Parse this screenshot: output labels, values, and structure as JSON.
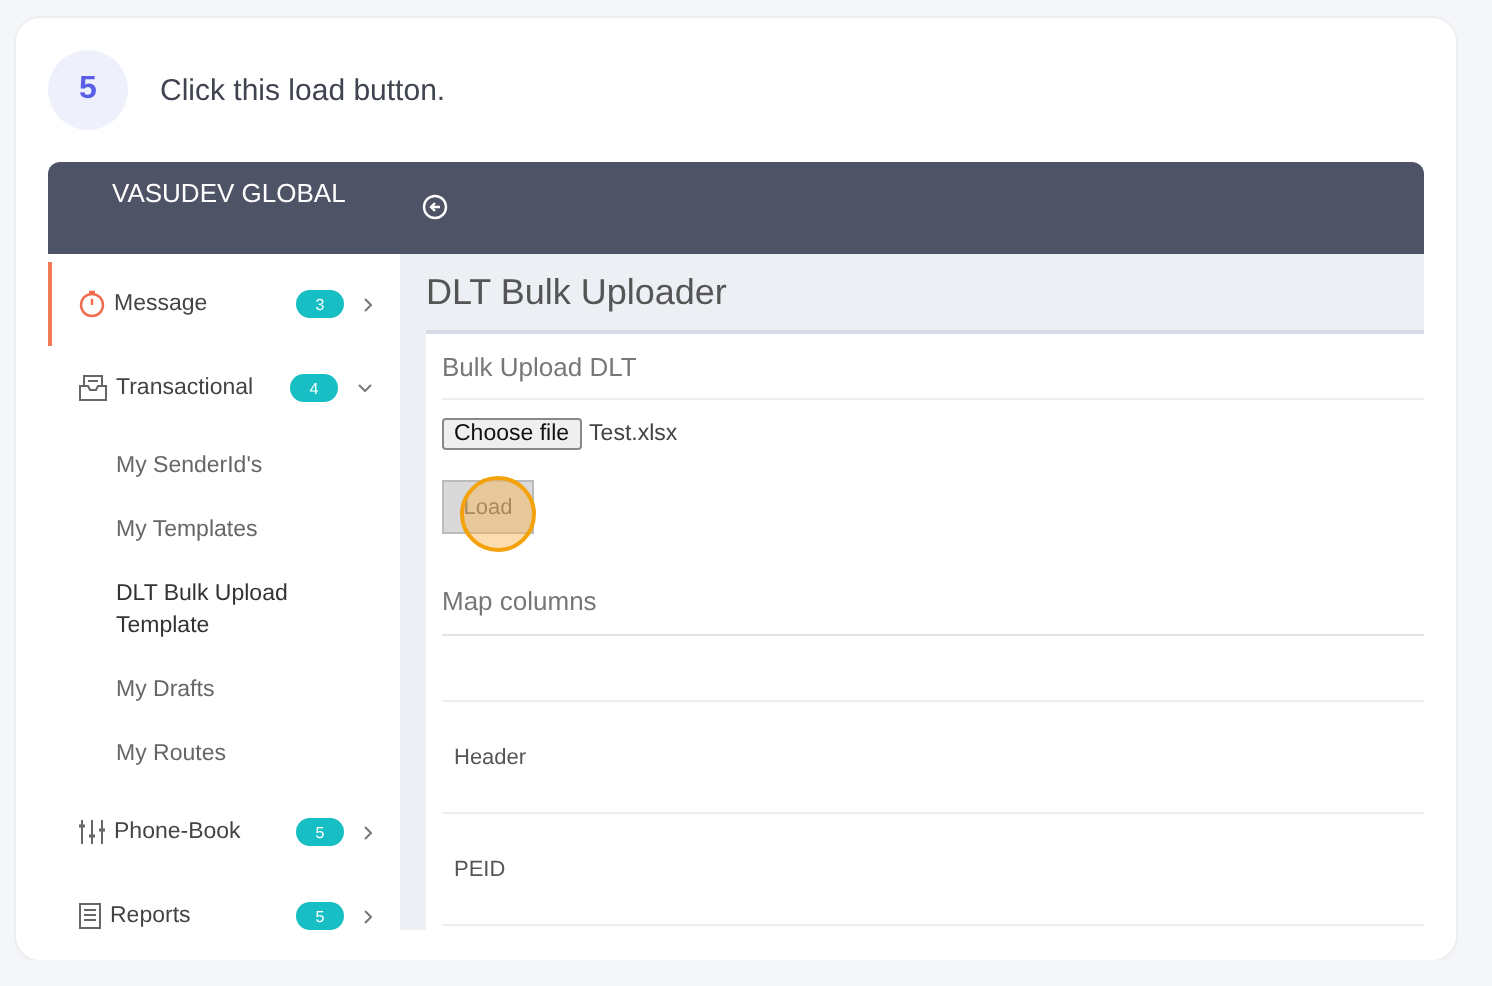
{
  "step": {
    "number": "5",
    "instruction": "Click this load button."
  },
  "app": {
    "brand": "VASUDEV GLOBAL",
    "sidebar": [
      {
        "label": "Message",
        "badge": "3",
        "selected": true,
        "expanded": false
      },
      {
        "label": "Transactional",
        "badge": "4",
        "selected": false,
        "expanded": true,
        "children": [
          {
            "label": "My SenderId's",
            "selected": false
          },
          {
            "label": "My Templates",
            "selected": false
          },
          {
            "label": "DLT Bulk Upload Template",
            "selected": true
          },
          {
            "label": "My Drafts",
            "selected": false
          },
          {
            "label": "My Routes",
            "selected": false
          }
        ]
      },
      {
        "label": "Phone-Book",
        "badge": "5",
        "selected": false,
        "expanded": false
      },
      {
        "label": "Reports",
        "badge": "5",
        "selected": false,
        "expanded": false
      }
    ],
    "page_title": "DLT Bulk Uploader",
    "panel_title": "Bulk Upload DLT",
    "file_button": "Choose file",
    "file_name": "Test.xlsx",
    "load_button": "Load",
    "map_title": "Map columns",
    "map_rows": [
      "Header",
      "PEID"
    ]
  }
}
